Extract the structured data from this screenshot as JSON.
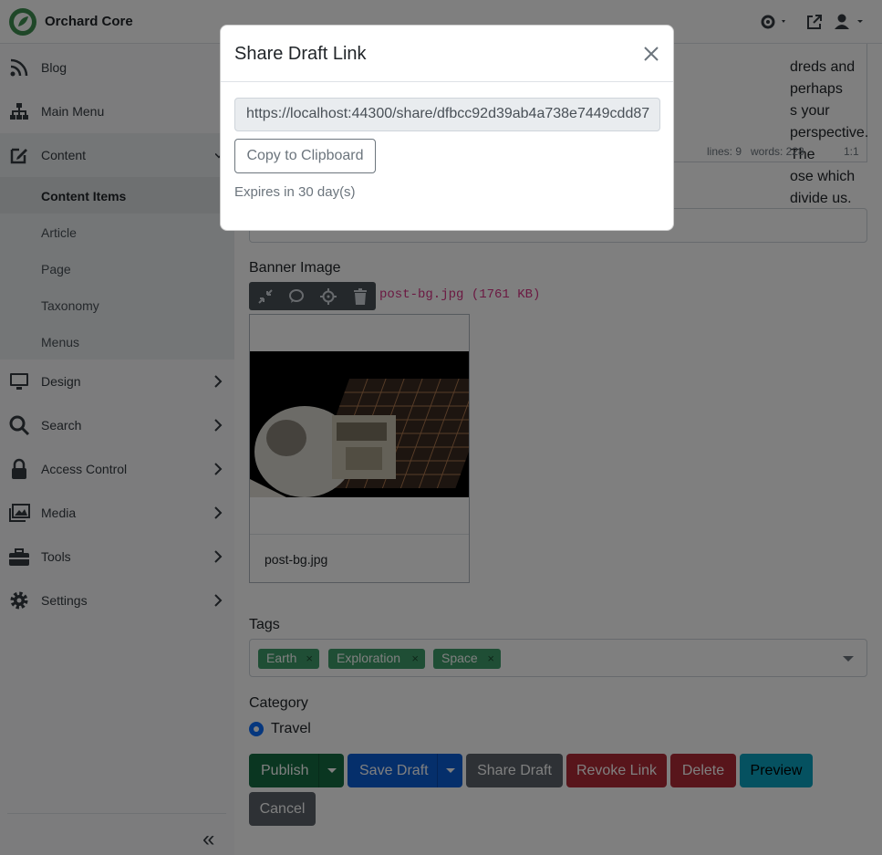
{
  "brand": {
    "name": "Orchard Core"
  },
  "sidebar": {
    "items": [
      {
        "label": "Blog"
      },
      {
        "label": "Main Menu"
      },
      {
        "label": "Content"
      },
      {
        "label": "Design"
      },
      {
        "label": "Search"
      },
      {
        "label": "Access Control"
      },
      {
        "label": "Media"
      },
      {
        "label": "Tools"
      },
      {
        "label": "Settings"
      }
    ],
    "content_sub": [
      "Content Items",
      "Article",
      "Page",
      "Taxonomy",
      "Menus"
    ],
    "collapse_glyph": "«"
  },
  "editor": {
    "lines": [
      "dreds and perhaps",
      "s your perspective. The",
      "ose which divide us."
    ],
    "status_lines": "lines: 9",
    "status_words": "words: 228",
    "status_pos": "1:1"
  },
  "banner": {
    "label": "Banner Image",
    "file_info": "post-bg.jpg (1761 KB)",
    "card_name": "post-bg.jpg"
  },
  "tags": {
    "label": "Tags",
    "items": [
      "Earth",
      "Exploration",
      "Space"
    ],
    "remove_glyph": "×"
  },
  "category": {
    "label": "Category",
    "option": "Travel"
  },
  "actions": {
    "publish": "Publish",
    "save_draft": "Save Draft",
    "share_draft": "Share Draft",
    "revoke_link": "Revoke Link",
    "delete": "Delete",
    "preview": "Preview",
    "cancel": "Cancel"
  },
  "modal": {
    "title": "Share Draft Link",
    "url": "https://localhost:44300/share/dfbcc92d39ab4a738e7449cdd87",
    "copy_label": "Copy to Clipboard",
    "expires": "Expires in 30 day(s)"
  },
  "colors": {
    "publish": "#146c43",
    "save_draft": "#0b5ed7",
    "share_draft": "#5c636a",
    "revoke": "#b02a37",
    "delete": "#b02a37",
    "preview": "#0aa2c0",
    "cancel": "#5c636a",
    "tag": "#3f9d6b"
  }
}
